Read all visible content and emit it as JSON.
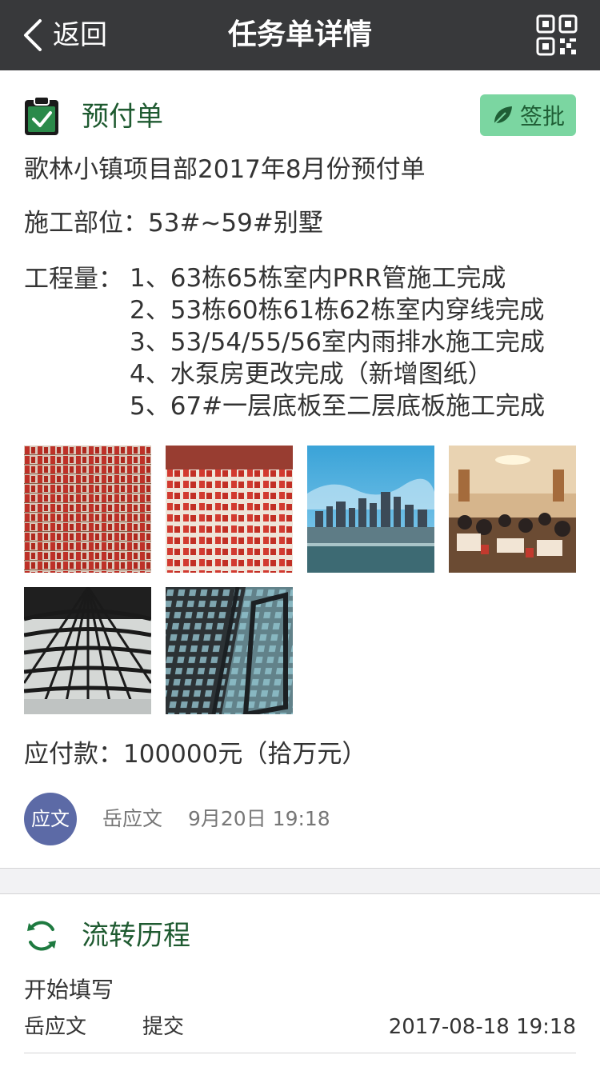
{
  "nav": {
    "back_label": "返回",
    "title": "任务单详情",
    "qr_icon": "qr-code-icon"
  },
  "card": {
    "title": "预付单",
    "approve_label": "签批",
    "doc_title": "歌林小镇项目部2017年8月份预付单",
    "site_label": "施工部位：",
    "site_value": "53#~59#别墅",
    "work_label": "工程量：",
    "work_items": [
      "1、63栋65栋室内PRR管施工完成",
      "2、53栋60栋61栋62栋室内穿线完成",
      "3、53/54/55/56室内雨排水施工完成",
      "4、水泵房更改完成（新增图纸）",
      "5、67#一层底板至二层底板施工完成"
    ],
    "photos": [
      "red-parcels-photo",
      "red-parcels-hall-photo",
      "city-skyline-photo",
      "banquet-room-photo",
      "glass-dome-photo",
      "glass-facade-photo"
    ],
    "amount": "应付款：100000元（拾万元）",
    "author": {
      "avatar_text": "应文",
      "name": "岳应文",
      "time": "9月20日 19:18"
    }
  },
  "history": {
    "title": "流转历程",
    "step": "开始填写",
    "entries": [
      {
        "user": "岳应文",
        "action": "提交",
        "datetime": "2017-08-18  19:18"
      }
    ]
  },
  "colors": {
    "nav_bg": "#38393b",
    "accent_green": "#1e5a30",
    "approve_bg": "#7bd6a1",
    "avatar_bg": "#5c6aa6"
  }
}
